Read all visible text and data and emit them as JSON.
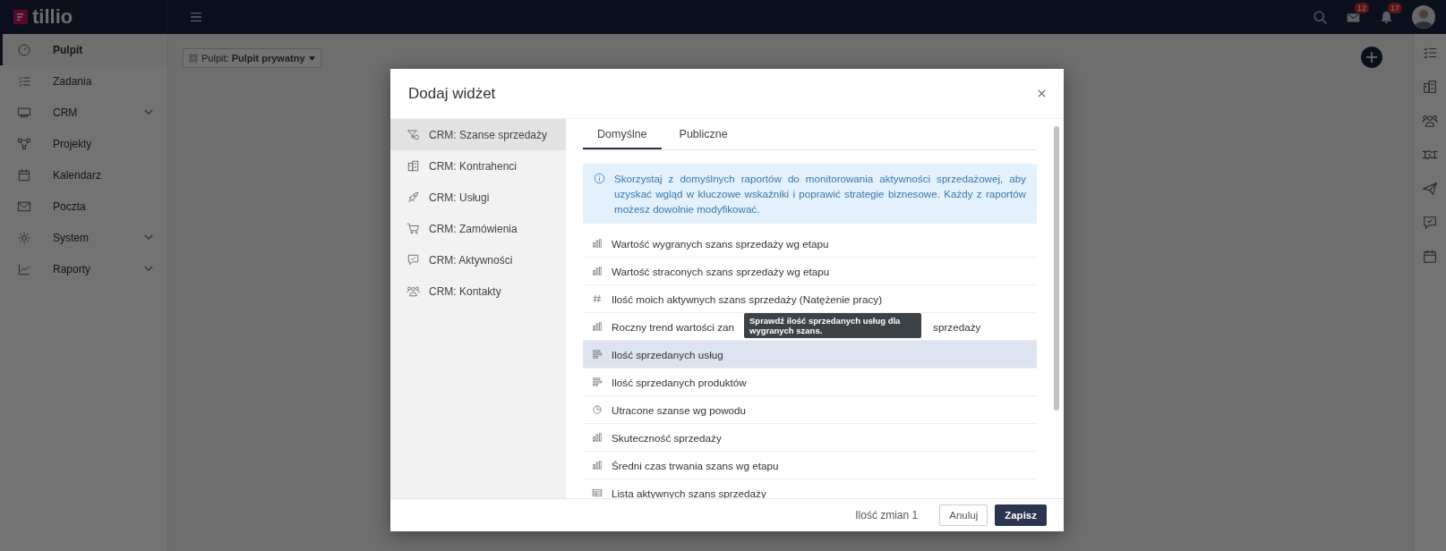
{
  "topbar": {
    "logo": "tillio",
    "mail_badge": "12",
    "bell_badge": "17"
  },
  "sidebar": {
    "items": [
      {
        "label": "Pulpit",
        "selected": true,
        "expandable": false
      },
      {
        "label": "Zadania",
        "selected": false,
        "expandable": false
      },
      {
        "label": "CRM",
        "selected": false,
        "expandable": true
      },
      {
        "label": "Projekty",
        "selected": false,
        "expandable": false
      },
      {
        "label": "Kalendarz",
        "selected": false,
        "expandable": false
      },
      {
        "label": "Poczta",
        "selected": false,
        "expandable": false
      },
      {
        "label": "System",
        "selected": false,
        "expandable": true
      },
      {
        "label": "Raporty",
        "selected": false,
        "expandable": true
      }
    ]
  },
  "dashboard": {
    "label": "Pulpit:",
    "value": "Pulpit prywatny"
  },
  "modal": {
    "title": "Dodaj widżet",
    "categories": [
      {
        "label": "CRM: Szanse sprzedaży",
        "selected": true
      },
      {
        "label": "CRM: Kontrahenci",
        "selected": false
      },
      {
        "label": "CRM: Usługi",
        "selected": false
      },
      {
        "label": "CRM: Zamówienia",
        "selected": false
      },
      {
        "label": "CRM: Aktywności",
        "selected": false
      },
      {
        "label": "CRM: Kontakty",
        "selected": false
      }
    ],
    "tabs": [
      {
        "label": "Domyślne",
        "selected": true
      },
      {
        "label": "Publiczne",
        "selected": false
      }
    ],
    "info": "Skorzystaj z domyślnych raportów do monitorowania aktywności sprzedażowej, aby uzyskać wgląd w kluczowe wskaźniki i poprawić strategie biznesowe. Każdy z raportów możesz dowolnie modyfikować.",
    "widgets": [
      {
        "title": "Wartość wygranych szans sprzedaży wg etapu",
        "kind": "bar",
        "selected": false
      },
      {
        "title": "Wartość straconych szans sprzedaży wg etapu",
        "kind": "bar",
        "selected": false
      },
      {
        "title": "Ilość moich aktywnych szans sprzedaży (Natężenie pracy)",
        "kind": "number",
        "selected": false
      },
      {
        "title": "Roczny trend wartości zan",
        "title_tail": "sprzedaży",
        "kind": "bar",
        "selected": false
      },
      {
        "title": "Ilość sprzedanych usług",
        "kind": "hbar",
        "selected": true
      },
      {
        "title": "Ilość sprzedanych produktów",
        "kind": "hbar",
        "selected": false
      },
      {
        "title": "Utracone szanse wg powodu",
        "kind": "pie",
        "selected": false
      },
      {
        "title": "Skuteczność sprzedaży",
        "kind": "bar",
        "selected": false
      },
      {
        "title": "Średni czas trwania szans wg etapu",
        "kind": "bar",
        "selected": false
      },
      {
        "title": "Lista aktywnych szans sprzedaży",
        "kind": "table",
        "selected": false
      }
    ],
    "tooltip": "Sprawdź ilość sprzedanych usług dla wygranych szans.",
    "changes": "Ilość zmian 1",
    "buttons": [
      {
        "label": "Anuluj",
        "kind": "secondary"
      },
      {
        "label": "Zapisz",
        "kind": "primary"
      }
    ]
  }
}
